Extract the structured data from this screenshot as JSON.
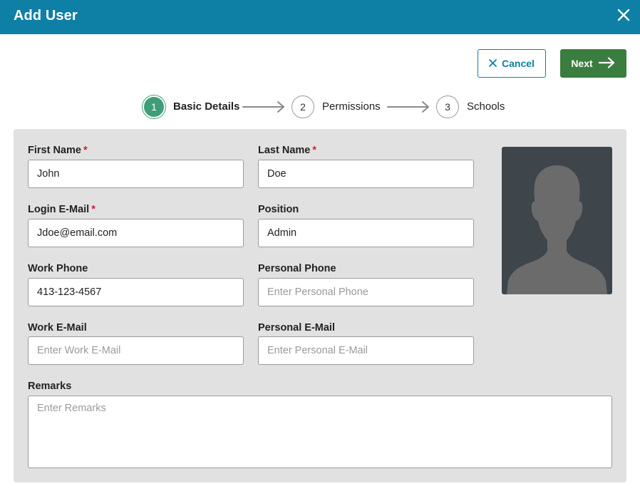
{
  "header": {
    "title": "Add User",
    "close_icon": "close-icon"
  },
  "toolbar": {
    "cancel_label": "Cancel",
    "next_label": "Next"
  },
  "stepper": {
    "steps": [
      {
        "number": "1",
        "label": "Basic Details",
        "active": true
      },
      {
        "number": "2",
        "label": "Permissions",
        "active": false
      },
      {
        "number": "3",
        "label": "Schools",
        "active": false
      }
    ]
  },
  "form": {
    "first_name": {
      "label": "First Name",
      "required_mark": "*",
      "value": "John"
    },
    "last_name": {
      "label": "Last Name",
      "required_mark": "*",
      "value": "Doe"
    },
    "login_email": {
      "label": "Login E-Mail",
      "required_mark": "*",
      "value": "Jdoe@email.com"
    },
    "position": {
      "label": "Position",
      "value": "Admin"
    },
    "work_phone": {
      "label": "Work Phone",
      "value": "413-123-4567"
    },
    "personal_phone": {
      "label": "Personal Phone",
      "value": "",
      "placeholder": "Enter Personal Phone"
    },
    "work_email": {
      "label": "Work E-Mail",
      "value": "",
      "placeholder": "Enter Work E-Mail"
    },
    "personal_email": {
      "label": "Personal E-Mail",
      "value": "",
      "placeholder": "Enter Personal E-Mail"
    },
    "remarks": {
      "label": "Remarks",
      "value": "",
      "placeholder": "Enter Remarks"
    }
  },
  "avatar": {
    "icon": "user-silhouette-icon"
  },
  "colors": {
    "header_bg": "#0e7fa5",
    "next_button_bg": "#3b7d3e",
    "active_step": "#3f9e79",
    "required_mark": "#d0202a",
    "panel_bg": "#e1e1e1"
  }
}
